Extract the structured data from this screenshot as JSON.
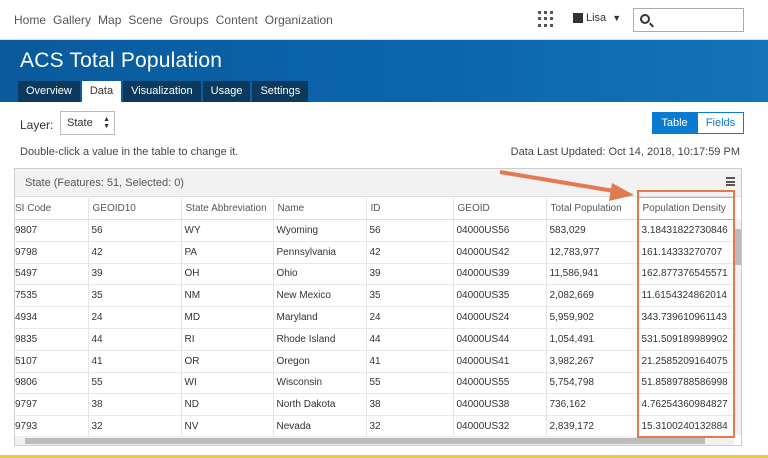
{
  "nav": {
    "links": [
      "Home",
      "Gallery",
      "Map",
      "Scene",
      "Groups",
      "Content",
      "Organization"
    ],
    "user": "Lisa"
  },
  "banner": {
    "title": "ACS Total Population"
  },
  "tabs": [
    {
      "label": "Overview"
    },
    {
      "label": "Data"
    },
    {
      "label": "Visualization"
    },
    {
      "label": "Usage"
    },
    {
      "label": "Settings"
    }
  ],
  "active_tab": "Data",
  "layer": {
    "label": "Layer:",
    "value": "State"
  },
  "view_buttons": {
    "table": "Table",
    "fields": "Fields"
  },
  "hint": "Double-click a value in the table to change it.",
  "last_updated": "Data Last Updated: Oct 14, 2018, 10:17:59 PM",
  "grid": {
    "title": "State (Features: 51, Selected: 0)",
    "columns": [
      "SI Code",
      "GEOID10",
      "State Abbreviation",
      "Name",
      "ID",
      "GEOID",
      "Total Population",
      "Population Density"
    ],
    "rows": [
      [
        "9807",
        "56",
        "WY",
        "Wyoming",
        "56",
        "04000US56",
        "583,029",
        "3.18431822730846"
      ],
      [
        "9798",
        "42",
        "PA",
        "Pennsylvania",
        "42",
        "04000US42",
        "12,783,977",
        "161.14333270707"
      ],
      [
        "5497",
        "39",
        "OH",
        "Ohio",
        "39",
        "04000US39",
        "11,586,941",
        "162.877376545571"
      ],
      [
        "7535",
        "35",
        "NM",
        "New Mexico",
        "35",
        "04000US35",
        "2,082,669",
        "11.6154324862014"
      ],
      [
        "4934",
        "24",
        "MD",
        "Maryland",
        "24",
        "04000US24",
        "5,959,902",
        "343.739610961143"
      ],
      [
        "9835",
        "44",
        "RI",
        "Rhode Island",
        "44",
        "04000US44",
        "1,054,491",
        "531.509189989902"
      ],
      [
        "5107",
        "41",
        "OR",
        "Oregon",
        "41",
        "04000US41",
        "3,982,267",
        "21.2585209164075"
      ],
      [
        "9806",
        "55",
        "WI",
        "Wisconsin",
        "55",
        "04000US55",
        "5,754,798",
        "51.8589788586998"
      ],
      [
        "9797",
        "38",
        "ND",
        "North Dakota",
        "38",
        "04000US38",
        "736,162",
        "4.76254360984827"
      ],
      [
        "9793",
        "32",
        "NV",
        "Nevada",
        "32",
        "04000US32",
        "2,839,172",
        "15.3100240132884"
      ]
    ]
  },
  "colors": {
    "banner": "#0b65ad",
    "tab_dark": "#0c3a5c",
    "accent": "#0b7ad1",
    "annotation": "#e3794f"
  },
  "icons": [
    "apps-grid-icon",
    "avatar-icon",
    "chevron-down-icon",
    "search-icon",
    "grid-menu-icon"
  ]
}
